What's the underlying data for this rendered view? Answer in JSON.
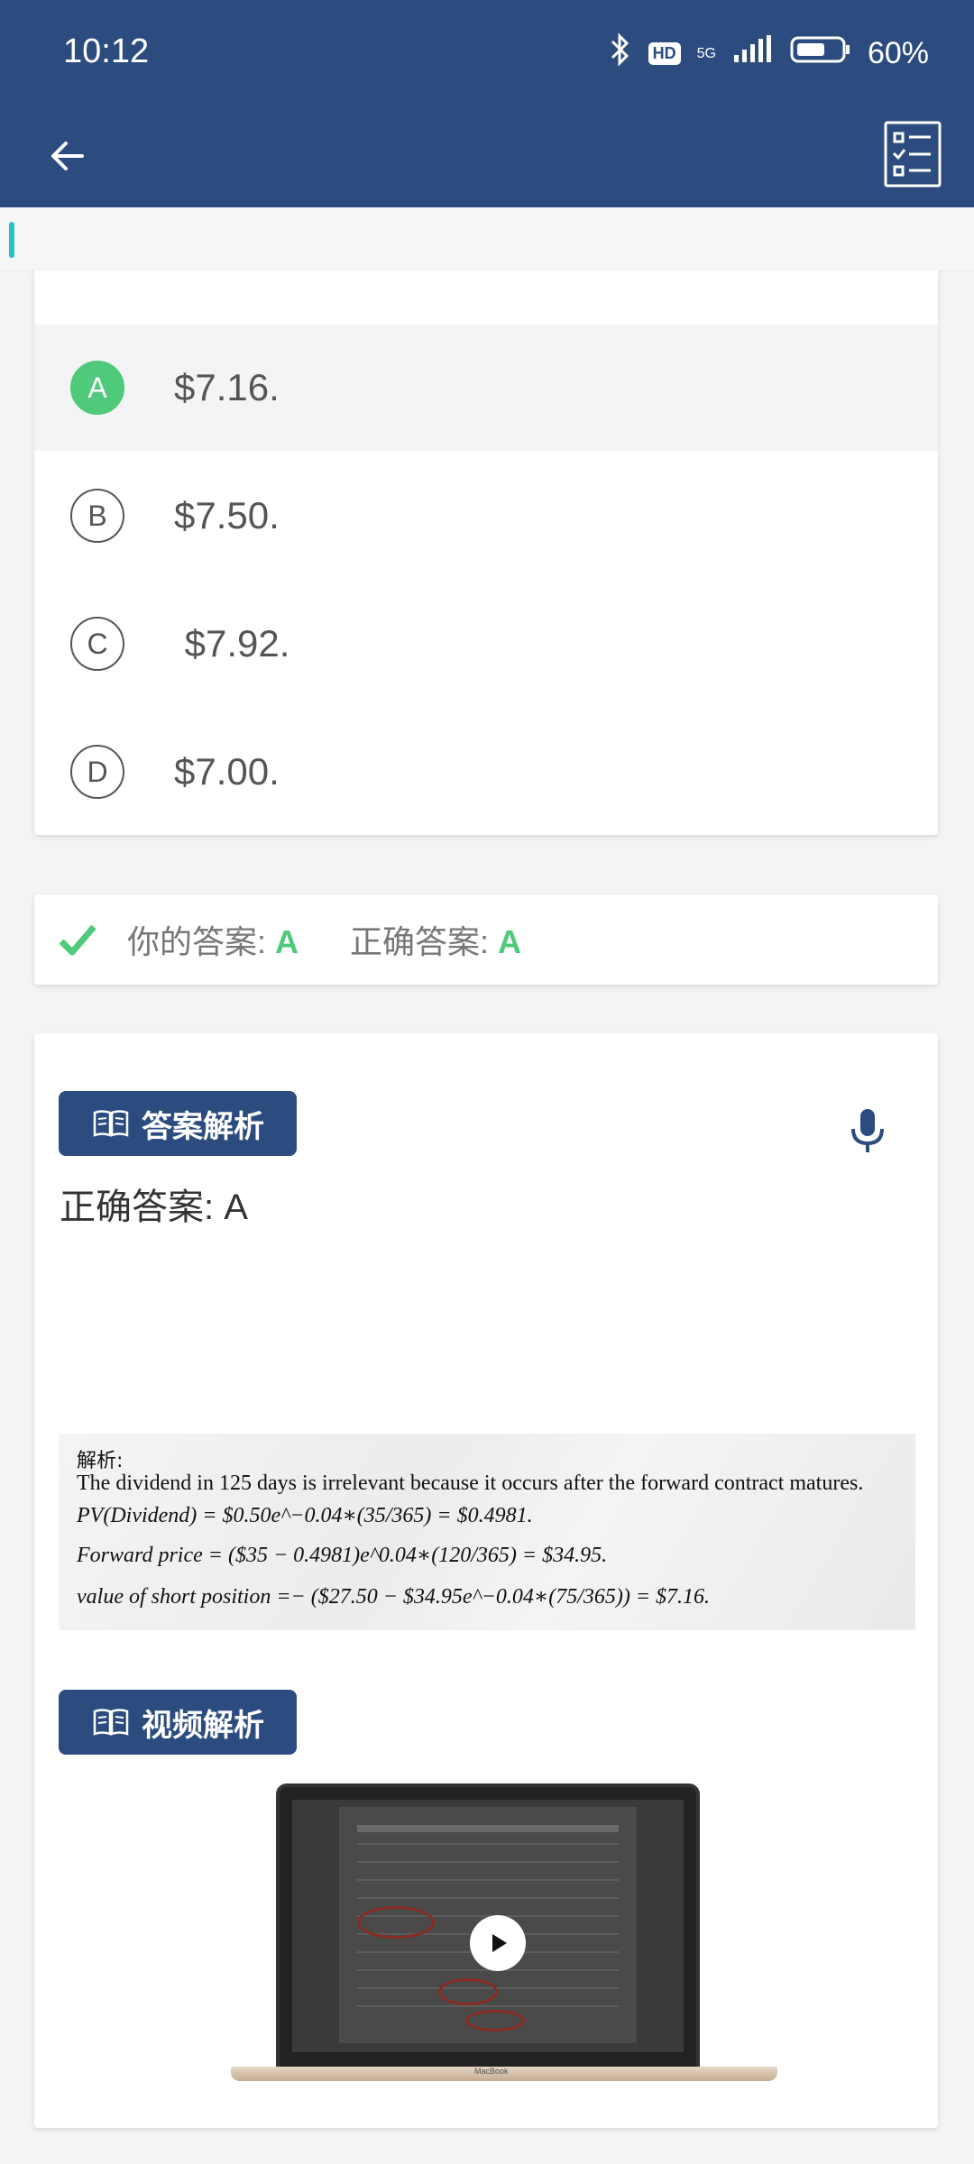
{
  "status_bar": {
    "time": "10:12",
    "network": "5G",
    "hd_label": "HD",
    "battery": "60%"
  },
  "app_bar": {
    "back_icon": "arrow-left-icon",
    "menu_icon": "checklist-icon"
  },
  "progress": {
    "fraction": 0.01
  },
  "options": [
    {
      "letter": "A",
      "text": "$7.16.",
      "selected": true
    },
    {
      "letter": "B",
      "text": "$7.50.",
      "selected": false
    },
    {
      "letter": "C",
      "text": " $7.92.",
      "selected": false
    },
    {
      "letter": "D",
      "text": "$7.00.",
      "selected": false
    }
  ],
  "answer": {
    "your_label": "你的答案:",
    "your_value": "A",
    "correct_label": "正确答案:",
    "correct_value": "A"
  },
  "analysis": {
    "button_label": "答案解析",
    "correct_line": "正确答案: A",
    "solution": {
      "header": "解析:",
      "line1": "The dividend in 125 days is irrelevant because it occurs after the forward contract matures.",
      "line2": "PV(Dividend) = $0.50e^−0.04∗(35/365) = $0.4981.",
      "line3": "Forward price = ($35 − 0.4981)e^0.04∗(120/365) = $34.95.",
      "line4": "value of short position =− ($27.50 − $34.95e^−0.04∗(75/365)) = $7.16."
    }
  },
  "video": {
    "button_label": "视频解析",
    "laptop_label": "MacBook"
  },
  "colors": {
    "primary": "#2c4c80",
    "correct": "#4fc97a",
    "progress": "#26c1c9"
  }
}
